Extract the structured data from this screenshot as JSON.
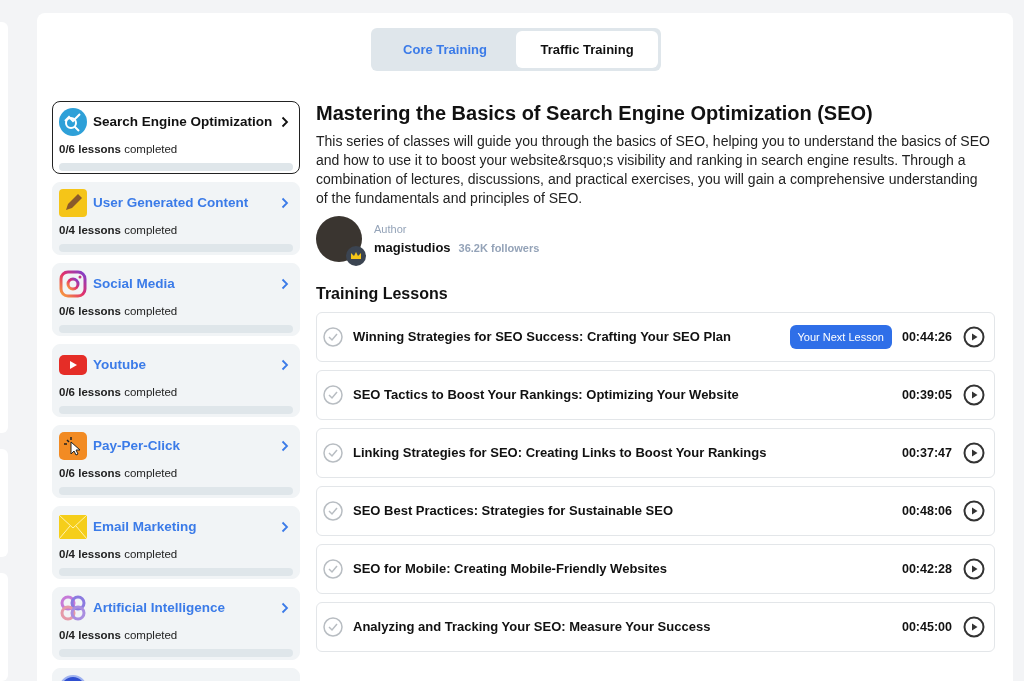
{
  "tabs": [
    {
      "label": "Core Training",
      "selected": false
    },
    {
      "label": "Traffic Training",
      "selected": true
    }
  ],
  "categories": [
    {
      "kind": "seo",
      "title": "Search Engine Optimization",
      "progress_text": "**0/6 lessons** completed",
      "level": 0,
      "selected": true
    },
    {
      "kind": "pencil",
      "title": "User Generated Content",
      "progress_text": "**0/4 lessons** completed",
      "level": 0,
      "selected": false
    },
    {
      "kind": "camera",
      "title": "Social Media",
      "progress_text": "**0/6 lessons** completed",
      "level": 0,
      "selected": false
    },
    {
      "kind": "play",
      "title": "Youtube",
      "progress_text": "**0/6 lessons** completed",
      "level": 0,
      "selected": false
    },
    {
      "kind": "cursor",
      "title": "Pay-Per-Click",
      "progress_text": "**0/6 lessons** completed",
      "level": 0,
      "selected": false
    },
    {
      "kind": "envelope",
      "title": "Email Marketing",
      "progress_text": "**0/4 lessons** completed",
      "level": 0,
      "selected": false
    },
    {
      "kind": "knot",
      "title": "Artificial Intelligence",
      "progress_text": "**0/4 lessons** completed",
      "level": 0,
      "selected": false
    },
    {
      "kind": "circle",
      "selected": false
    }
  ],
  "course": {
    "title": "Mastering the Basics of Search Engine Optimization (SEO)",
    "description": "This series of classes will guide you through the basics of SEO, helping you to understand the basics of SEO and how to use it to boost your website&rsquo;s visibility and ranking in search engine results. Through a combination of lectures, discussions, and practical exercises, you will gain a comprehensive understanding of the fundamentals and principles of SEO.",
    "author_label": "Author",
    "author_name": "magistudios",
    "followers": "36.2K followers"
  },
  "lessons_heading": "Training Lessons",
  "lessons": [
    {
      "title": "Winning Strategies for SEO Success: Crafting Your SEO Plan",
      "badge": "Your Next Lesson",
      "duration": "00:44:26",
      "completed": false
    },
    {
      "title": "SEO Tactics to Boost Your Rankings: Optimizing Your Website",
      "duration": "00:39:05",
      "completed": false
    },
    {
      "title": "Linking Strategies for SEO: Creating Links to Boost Your Rankings",
      "duration": "00:37:47",
      "completed": false
    },
    {
      "title": "SEO Best Practices: Strategies for Sustainable SEO",
      "duration": "00:48:06",
      "completed": false
    },
    {
      "title": "SEO for Mobile: Creating Mobile-Friendly Websites",
      "duration": "00:42:28",
      "completed": false
    },
    {
      "title": "Analyzing and Tracking Your SEO: Measure Your Success",
      "duration": "00:45:00",
      "completed": false
    }
  ]
}
